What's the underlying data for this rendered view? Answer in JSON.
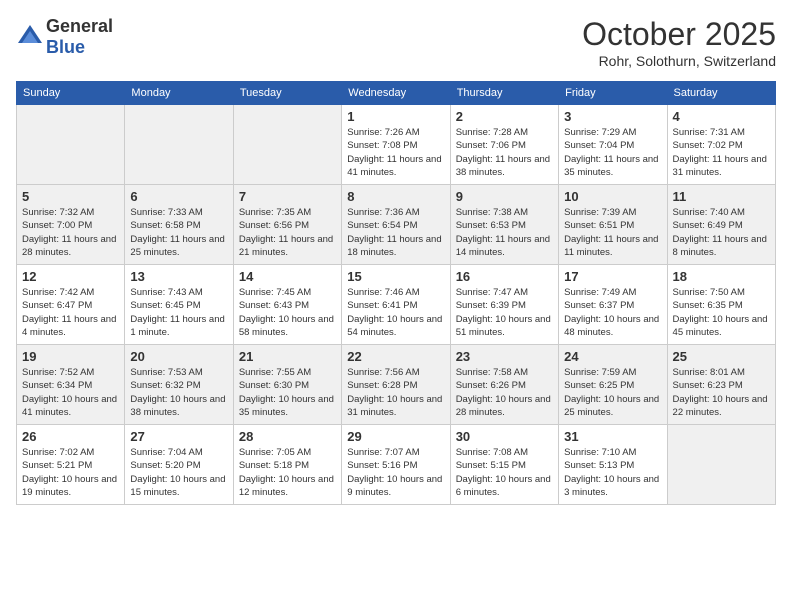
{
  "header": {
    "logo_general": "General",
    "logo_blue": "Blue",
    "title": "October 2025",
    "location": "Rohr, Solothurn, Switzerland"
  },
  "days_of_week": [
    "Sunday",
    "Monday",
    "Tuesday",
    "Wednesday",
    "Thursday",
    "Friday",
    "Saturday"
  ],
  "weeks": [
    [
      {
        "day": "",
        "info": ""
      },
      {
        "day": "",
        "info": ""
      },
      {
        "day": "",
        "info": ""
      },
      {
        "day": "1",
        "info": "Sunrise: 7:26 AM\nSunset: 7:08 PM\nDaylight: 11 hours and 41 minutes."
      },
      {
        "day": "2",
        "info": "Sunrise: 7:28 AM\nSunset: 7:06 PM\nDaylight: 11 hours and 38 minutes."
      },
      {
        "day": "3",
        "info": "Sunrise: 7:29 AM\nSunset: 7:04 PM\nDaylight: 11 hours and 35 minutes."
      },
      {
        "day": "4",
        "info": "Sunrise: 7:31 AM\nSunset: 7:02 PM\nDaylight: 11 hours and 31 minutes."
      }
    ],
    [
      {
        "day": "5",
        "info": "Sunrise: 7:32 AM\nSunset: 7:00 PM\nDaylight: 11 hours and 28 minutes."
      },
      {
        "day": "6",
        "info": "Sunrise: 7:33 AM\nSunset: 6:58 PM\nDaylight: 11 hours and 25 minutes."
      },
      {
        "day": "7",
        "info": "Sunrise: 7:35 AM\nSunset: 6:56 PM\nDaylight: 11 hours and 21 minutes."
      },
      {
        "day": "8",
        "info": "Sunrise: 7:36 AM\nSunset: 6:54 PM\nDaylight: 11 hours and 18 minutes."
      },
      {
        "day": "9",
        "info": "Sunrise: 7:38 AM\nSunset: 6:53 PM\nDaylight: 11 hours and 14 minutes."
      },
      {
        "day": "10",
        "info": "Sunrise: 7:39 AM\nSunset: 6:51 PM\nDaylight: 11 hours and 11 minutes."
      },
      {
        "day": "11",
        "info": "Sunrise: 7:40 AM\nSunset: 6:49 PM\nDaylight: 11 hours and 8 minutes."
      }
    ],
    [
      {
        "day": "12",
        "info": "Sunrise: 7:42 AM\nSunset: 6:47 PM\nDaylight: 11 hours and 4 minutes."
      },
      {
        "day": "13",
        "info": "Sunrise: 7:43 AM\nSunset: 6:45 PM\nDaylight: 11 hours and 1 minute."
      },
      {
        "day": "14",
        "info": "Sunrise: 7:45 AM\nSunset: 6:43 PM\nDaylight: 10 hours and 58 minutes."
      },
      {
        "day": "15",
        "info": "Sunrise: 7:46 AM\nSunset: 6:41 PM\nDaylight: 10 hours and 54 minutes."
      },
      {
        "day": "16",
        "info": "Sunrise: 7:47 AM\nSunset: 6:39 PM\nDaylight: 10 hours and 51 minutes."
      },
      {
        "day": "17",
        "info": "Sunrise: 7:49 AM\nSunset: 6:37 PM\nDaylight: 10 hours and 48 minutes."
      },
      {
        "day": "18",
        "info": "Sunrise: 7:50 AM\nSunset: 6:35 PM\nDaylight: 10 hours and 45 minutes."
      }
    ],
    [
      {
        "day": "19",
        "info": "Sunrise: 7:52 AM\nSunset: 6:34 PM\nDaylight: 10 hours and 41 minutes."
      },
      {
        "day": "20",
        "info": "Sunrise: 7:53 AM\nSunset: 6:32 PM\nDaylight: 10 hours and 38 minutes."
      },
      {
        "day": "21",
        "info": "Sunrise: 7:55 AM\nSunset: 6:30 PM\nDaylight: 10 hours and 35 minutes."
      },
      {
        "day": "22",
        "info": "Sunrise: 7:56 AM\nSunset: 6:28 PM\nDaylight: 10 hours and 31 minutes."
      },
      {
        "day": "23",
        "info": "Sunrise: 7:58 AM\nSunset: 6:26 PM\nDaylight: 10 hours and 28 minutes."
      },
      {
        "day": "24",
        "info": "Sunrise: 7:59 AM\nSunset: 6:25 PM\nDaylight: 10 hours and 25 minutes."
      },
      {
        "day": "25",
        "info": "Sunrise: 8:01 AM\nSunset: 6:23 PM\nDaylight: 10 hours and 22 minutes."
      }
    ],
    [
      {
        "day": "26",
        "info": "Sunrise: 7:02 AM\nSunset: 5:21 PM\nDaylight: 10 hours and 19 minutes."
      },
      {
        "day": "27",
        "info": "Sunrise: 7:04 AM\nSunset: 5:20 PM\nDaylight: 10 hours and 15 minutes."
      },
      {
        "day": "28",
        "info": "Sunrise: 7:05 AM\nSunset: 5:18 PM\nDaylight: 10 hours and 12 minutes."
      },
      {
        "day": "29",
        "info": "Sunrise: 7:07 AM\nSunset: 5:16 PM\nDaylight: 10 hours and 9 minutes."
      },
      {
        "day": "30",
        "info": "Sunrise: 7:08 AM\nSunset: 5:15 PM\nDaylight: 10 hours and 6 minutes."
      },
      {
        "day": "31",
        "info": "Sunrise: 7:10 AM\nSunset: 5:13 PM\nDaylight: 10 hours and 3 minutes."
      },
      {
        "day": "",
        "info": ""
      }
    ]
  ]
}
